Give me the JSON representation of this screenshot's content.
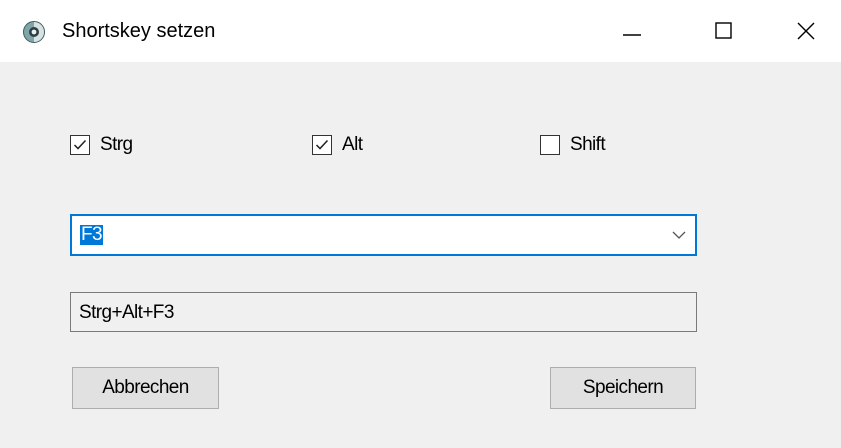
{
  "window": {
    "title": "Shortskey setzen",
    "icon": "app-icon"
  },
  "modifiers": [
    {
      "label": "Strg",
      "checked": true
    },
    {
      "label": "Alt",
      "checked": true
    },
    {
      "label": "Shift",
      "checked": false
    }
  ],
  "key_select": {
    "value": "F3"
  },
  "shortcut_preview": {
    "value": "Strg+Alt+F3"
  },
  "buttons": {
    "cancel_label": "Abbrechen",
    "save_label": "Speichern"
  },
  "colors": {
    "accent": "#0078d7",
    "window_bg": "#f0f0f0",
    "button_bg": "#e1e1e1"
  }
}
